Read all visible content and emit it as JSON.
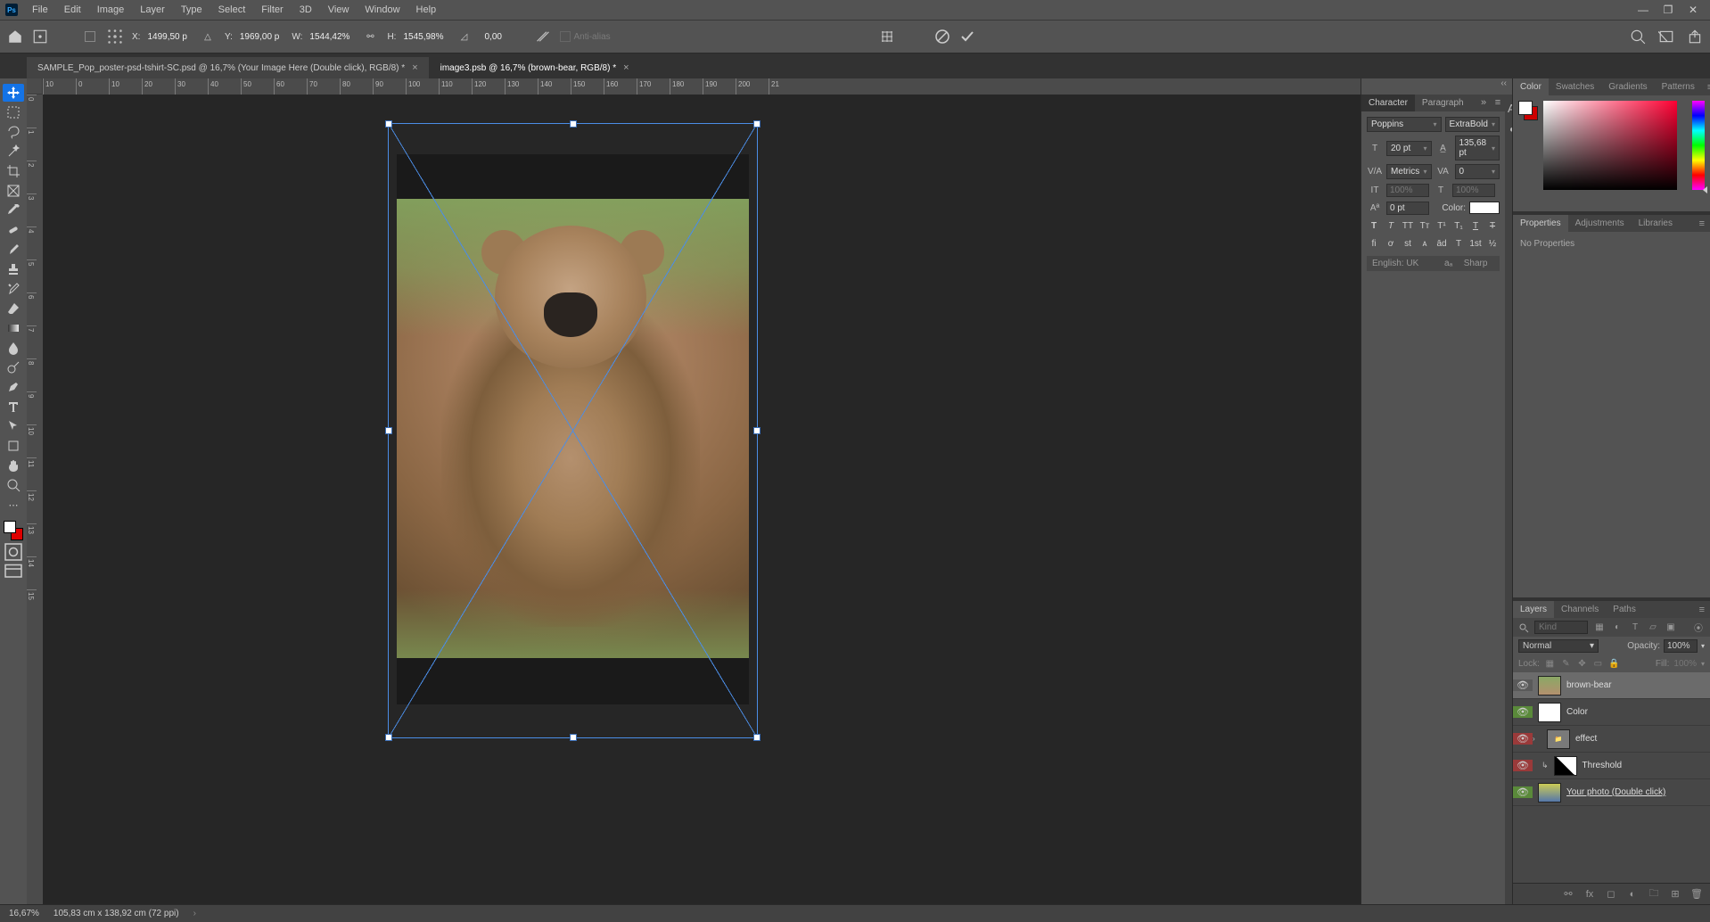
{
  "menu": {
    "items": [
      "File",
      "Edit",
      "Image",
      "Layer",
      "Type",
      "Select",
      "Filter",
      "3D",
      "View",
      "Window",
      "Help"
    ]
  },
  "options": {
    "x_label": "X:",
    "x": "1499,50 p",
    "y_label": "Y:",
    "y": "1969,00 p",
    "w_label": "W:",
    "w": "1544,42%",
    "h_label": "H:",
    "h": "1545,98%",
    "rot": "0,00",
    "aa": "Anti-alias"
  },
  "tabs": [
    {
      "title": "SAMPLE_Pop_poster-psd-tshirt-SC.psd @ 16,7% (Your Image Here (Double click), RGB/8) *",
      "active": false
    },
    {
      "title": "image3.psb @ 16,7% (brown-bear, RGB/8) *",
      "active": true
    }
  ],
  "ruler_h": [
    "10",
    "0",
    "10",
    "20",
    "30",
    "40",
    "50",
    "60",
    "70",
    "80",
    "90",
    "100",
    "110",
    "120",
    "130",
    "140",
    "150",
    "160",
    "170",
    "180",
    "190",
    "200",
    "21"
  ],
  "ruler_v": [
    "0",
    "1",
    "2",
    "3",
    "4",
    "5",
    "6",
    "7",
    "8",
    "9",
    "10",
    "11",
    "12",
    "13",
    "14",
    "15"
  ],
  "char_panel": {
    "tabs": {
      "char": "Character",
      "para": "Paragraph"
    },
    "font": "Poppins",
    "weight": "ExtraBold",
    "size": "20 pt",
    "leading": "135,68 pt",
    "kern": "Metrics",
    "tracking": "0",
    "vscale": "100%",
    "hscale": "100%",
    "baseline": "0 pt",
    "color_label": "Color:",
    "lang": "English: UK",
    "aa": "Sharp"
  },
  "right": {
    "color_tabs": [
      "Color",
      "Swatches",
      "Gradients",
      "Patterns"
    ],
    "prop_tabs": [
      "Properties",
      "Adjustments",
      "Libraries"
    ],
    "no_props": "No Properties",
    "layer_tabs": [
      "Layers",
      "Channels",
      "Paths"
    ],
    "kind_ph": "Kind",
    "blend": "Normal",
    "opacity_label": "Opacity:",
    "opacity": "100%",
    "lock_label": "Lock:",
    "fill_label": "Fill:",
    "fill": "100%"
  },
  "layers": [
    {
      "name": "brown-bear",
      "eye": "gray",
      "sel": true,
      "thumb": "🐻"
    },
    {
      "name": "Color",
      "eye": "green",
      "thumb": "▦"
    },
    {
      "name": "effect",
      "eye": "red",
      "folder": true,
      "collapsed": true
    },
    {
      "name": "Threshold",
      "eye": "red",
      "adj": true
    },
    {
      "name": "Your photo (Double click)",
      "eye": "green",
      "under": true,
      "thumb": "🖼"
    }
  ],
  "status": {
    "zoom": "16,67%",
    "docinfo": "105,83 cm x 138,92 cm (72 ppi)"
  }
}
